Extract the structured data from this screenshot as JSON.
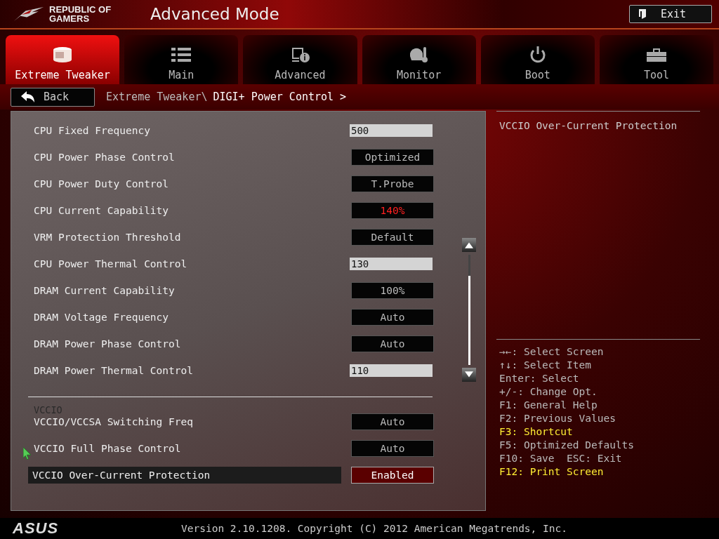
{
  "header": {
    "brand_line_1": "REPUBLIC OF",
    "brand_line_2": "GAMERS",
    "title": "Advanced Mode",
    "exit_button": "Exit"
  },
  "tabs": [
    {
      "label": "Extreme Tweaker",
      "selected": true
    },
    {
      "label": "Main",
      "selected": false
    },
    {
      "label": "Advanced",
      "selected": false
    },
    {
      "label": "Monitor",
      "selected": false
    },
    {
      "label": "Boot",
      "selected": false
    },
    {
      "label": "Tool",
      "selected": false
    }
  ],
  "back_button": "Back",
  "breadcrumb": {
    "parent": "Extreme Tweaker\\",
    "current": "DIGI+ Power Control >"
  },
  "settings": [
    {
      "label": "CPU Fixed Frequency",
      "kind": "input",
      "value": "500",
      "selected": false
    },
    {
      "label": "CPU Power Phase Control",
      "kind": "select",
      "value": "Optimized",
      "warning": false,
      "selected": false
    },
    {
      "label": "CPU Power Duty Control",
      "kind": "select",
      "value": "T.Probe",
      "warning": false,
      "selected": false
    },
    {
      "label": "CPU Current Capability",
      "kind": "select",
      "value": "140%",
      "warning": true,
      "selected": false
    },
    {
      "label": "VRM Protection Threshold",
      "kind": "select",
      "value": "Default",
      "warning": false,
      "selected": false
    },
    {
      "label": "CPU Power Thermal Control",
      "kind": "input",
      "value": "130",
      "selected": false
    },
    {
      "label": "DRAM Current Capability",
      "kind": "select",
      "value": "100%",
      "warning": false,
      "selected": false
    },
    {
      "label": "DRAM Voltage Frequency",
      "kind": "select",
      "value": "Auto",
      "warning": false,
      "selected": false
    },
    {
      "label": "DRAM Power Phase Control",
      "kind": "select",
      "value": "Auto",
      "warning": false,
      "selected": false
    },
    {
      "label": "DRAM Power Thermal Control",
      "kind": "input",
      "value": "110",
      "selected": false
    }
  ],
  "vccio_section": {
    "heading": "VCCIO",
    "settings": [
      {
        "label": "VCCIO/VCCSA Switching Freq",
        "kind": "select",
        "value": "Auto",
        "warning": false,
        "selected": false
      },
      {
        "label": "VCCIO Full Phase Control",
        "kind": "select",
        "value": "Auto",
        "warning": false,
        "selected": false
      },
      {
        "label": "VCCIO Over-Current Protection",
        "kind": "select",
        "value": "Enabled",
        "warning": false,
        "selected": true
      }
    ]
  },
  "help_text": "VCCIO Over-Current Protection",
  "key_help": [
    {
      "text": "→←: Select Screen",
      "highlight": false
    },
    {
      "text": "↑↓: Select Item",
      "highlight": false
    },
    {
      "text": "Enter: Select",
      "highlight": false
    },
    {
      "text": "+/-: Change Opt.",
      "highlight": false
    },
    {
      "text": "F1: General Help",
      "highlight": false
    },
    {
      "text": "F2: Previous Values",
      "highlight": false
    },
    {
      "text": "F3: Shortcut",
      "highlight": true
    },
    {
      "text": "F5: Optimized Defaults",
      "highlight": false
    },
    {
      "text": "F10: Save  ESC: Exit",
      "highlight": false
    },
    {
      "text": "F12: Print Screen",
      "highlight": true
    }
  ],
  "footer": {
    "logo": "ASUS",
    "version": "Version 2.10.1208. Copyright (C) 2012 American Megatrends, Inc."
  }
}
